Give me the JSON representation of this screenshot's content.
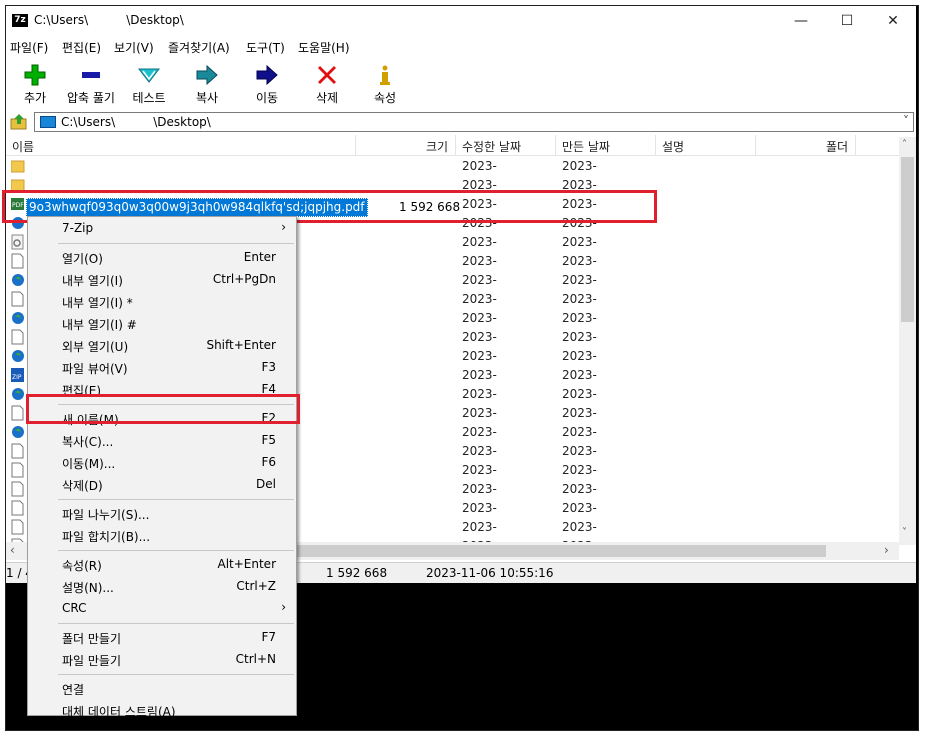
{
  "window": {
    "title": "C:\\Users\\          \\Desktop\\",
    "minimize_glyph": "—",
    "maximize_glyph": "☐",
    "close_glyph": "✕"
  },
  "menu": [
    "파일(F)",
    "편집(E)",
    "보기(V)",
    "즐겨찾기(A)",
    "도구(T)",
    "도움말(H)"
  ],
  "toolbar": [
    {
      "label": "추가",
      "icon": "plus-icon",
      "color": "#00b000"
    },
    {
      "label": "압축 풀기",
      "icon": "minus-icon",
      "color": "#1a1aa8"
    },
    {
      "label": "테스트",
      "icon": "check-icon",
      "color": "#18a8b8"
    },
    {
      "label": "복사",
      "icon": "copy-arrow-icon",
      "color": "#1a7a8a"
    },
    {
      "label": "이동",
      "icon": "move-arrow-icon",
      "color": "#10108a"
    },
    {
      "label": "삭제",
      "icon": "delete-x-icon",
      "color": "#e01010"
    },
    {
      "label": "속성",
      "icon": "info-icon",
      "color": "#d0a000"
    }
  ],
  "address": {
    "path": "C:\\Users\\          \\Desktop\\"
  },
  "columns": [
    "이름",
    "크기",
    "수정한 날짜",
    "만든 날짜",
    "설명",
    "폴더"
  ],
  "selected_file": {
    "name": "9o3whwqf093q0w3q00w9j3qh0w984qlkfq'sd;jqpjhg.pdf",
    "size": "1 592 668",
    "modified": "2023-",
    "created": "2023-"
  },
  "rows": [
    {
      "icon": "folder-icon",
      "modified": "2023-",
      "created": "2023-"
    },
    {
      "icon": "folder-icon",
      "modified": "2023-",
      "created": "2023-"
    },
    {
      "icon": "pdf-icon",
      "modified": "2023-",
      "created": "2023-"
    },
    {
      "icon": "globe-icon",
      "modified": "2023-",
      "created": "2023-"
    },
    {
      "icon": "gear-file-icon",
      "modified": "2023-",
      "created": "2023-"
    },
    {
      "icon": "file-icon",
      "modified": "2023-",
      "created": "2023-"
    },
    {
      "icon": "globe-icon",
      "modified": "2023-",
      "created": "2023-"
    },
    {
      "icon": "file-icon",
      "modified": "2023-",
      "created": "2023-"
    },
    {
      "icon": "globe-icon",
      "modified": "2023-",
      "created": "2023-"
    },
    {
      "icon": "file-icon",
      "modified": "2023-",
      "created": "2023-"
    },
    {
      "icon": "globe-icon",
      "modified": "2023-",
      "created": "2023-"
    },
    {
      "icon": "zip-icon",
      "modified": "2023-",
      "created": "2023-"
    },
    {
      "icon": "globe-icon",
      "modified": "2023-",
      "created": "2023-"
    },
    {
      "icon": "file-icon",
      "modified": "2023-",
      "created": "2023-"
    },
    {
      "icon": "globe-icon",
      "modified": "2023-",
      "created": "2023-"
    },
    {
      "icon": "file-icon",
      "modified": "2023-",
      "created": "2023-"
    },
    {
      "icon": "file-icon",
      "modified": "2023-",
      "created": "2023-"
    },
    {
      "icon": "file-icon",
      "modified": "2023-",
      "created": "2023-"
    },
    {
      "icon": "file-icon",
      "modified": "2023-",
      "created": "2023-"
    },
    {
      "icon": "file-icon",
      "modified": "2023-",
      "created": "2023-"
    },
    {
      "icon": "file-icon",
      "modified": "2023-",
      "created": "2023-"
    }
  ],
  "status": {
    "count": "1 / 4",
    "size": "1 592 668",
    "modified": "2023-11-06 10:55:16"
  },
  "context_menu": {
    "items": [
      {
        "label": "7-Zip",
        "shortcut": "",
        "submenu": true
      },
      {
        "label": "열기(O)",
        "shortcut": "Enter"
      },
      {
        "label": "내부 열기(I)",
        "shortcut": "Ctrl+PgDn"
      },
      {
        "label": "내부 열기(I) *",
        "shortcut": ""
      },
      {
        "label": "내부 열기(I) #",
        "shortcut": ""
      },
      {
        "label": "외부 열기(U)",
        "shortcut": "Shift+Enter"
      },
      {
        "label": "파일 뷰어(V)",
        "shortcut": "F3"
      },
      {
        "label": "편집(E)",
        "shortcut": "F4"
      },
      {
        "label": "새 이름(M)",
        "shortcut": "F2",
        "highlighted": true
      },
      {
        "label": "복사(C)...",
        "shortcut": "F5"
      },
      {
        "label": "이동(M)...",
        "shortcut": "F6"
      },
      {
        "label": "삭제(D)",
        "shortcut": "Del"
      },
      {
        "label": "파일 나누기(S)...",
        "shortcut": ""
      },
      {
        "label": "파일 합치기(B)...",
        "shortcut": ""
      },
      {
        "label": "속성(R)",
        "shortcut": "Alt+Enter"
      },
      {
        "label": "설명(N)...",
        "shortcut": "Ctrl+Z"
      },
      {
        "label": "CRC",
        "shortcut": "",
        "submenu": true
      },
      {
        "label": "폴더 만들기",
        "shortcut": "F7"
      },
      {
        "label": "파일 만들기",
        "shortcut": "Ctrl+N"
      },
      {
        "label": "연결",
        "shortcut": ""
      },
      {
        "label": "대체 데이터 스트림(A)",
        "shortcut": ""
      }
    ],
    "submenu_glyph": "›"
  },
  "scroll": {
    "up": "˄",
    "down": "˅",
    "left": "‹",
    "right": "›"
  },
  "colors": {
    "highlight_red": "#e0202e",
    "selection_blue": "#0078d7"
  }
}
